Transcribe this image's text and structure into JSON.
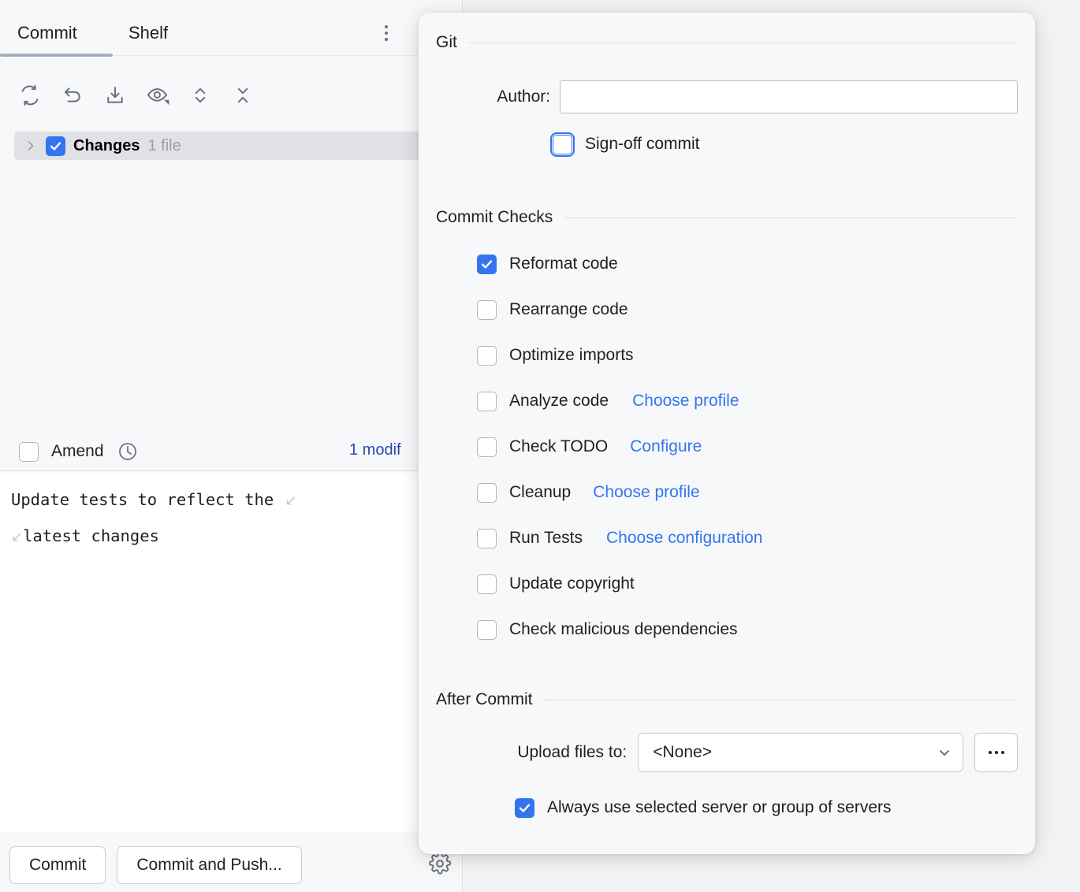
{
  "tool_window": {
    "tabs": [
      {
        "label": "Commit",
        "selected": true
      },
      {
        "label": "Shelf",
        "selected": false
      }
    ],
    "overflow_menu_icon": "kebab-menu-icon",
    "toolbar_icons": [
      "refresh-icon",
      "rollback-icon",
      "shelve-icon",
      "show-diff-eye-icon",
      "expand-all-icon",
      "collapse-all-icon"
    ],
    "changes_tree": {
      "expand_chevron": "chevron-right-icon",
      "checked": true,
      "label": "Changes",
      "count": "1 file"
    },
    "amend": {
      "checked": false,
      "label": "Amend",
      "history_icon": "clock-icon",
      "modified_link": "1 modif"
    },
    "commit_message": {
      "line1": "Update tests to reflect the",
      "line2": "latest changes",
      "wrap_marker": "↙"
    },
    "buttons": {
      "commit": "Commit",
      "commit_and_push": "Commit and Push...",
      "settings_icon": "gear-icon"
    }
  },
  "popup": {
    "git_section": {
      "title": "Git",
      "author_label": "Author:",
      "author_value": "",
      "author_placeholder": "",
      "signoff": {
        "label": "Sign-off commit",
        "checked": false,
        "focused": true
      }
    },
    "commit_checks_section": {
      "title": "Commit Checks",
      "items": [
        {
          "label": "Reformat code",
          "checked": true,
          "link": ""
        },
        {
          "label": "Rearrange code",
          "checked": false,
          "link": ""
        },
        {
          "label": "Optimize imports",
          "checked": false,
          "link": ""
        },
        {
          "label": "Analyze code",
          "checked": false,
          "link": "Choose profile"
        },
        {
          "label": "Check TODO",
          "checked": false,
          "link": "Configure"
        },
        {
          "label": "Cleanup",
          "checked": false,
          "link": "Choose profile"
        },
        {
          "label": "Run Tests",
          "checked": false,
          "link": "Choose configuration"
        },
        {
          "label": "Update copyright",
          "checked": false,
          "link": ""
        },
        {
          "label": "Check malicious dependencies",
          "checked": false,
          "link": ""
        }
      ]
    },
    "after_commit_section": {
      "title": "After Commit",
      "upload_label": "Upload files to:",
      "upload_value": "<None>",
      "upload_chevron_icon": "chevron-down-icon",
      "browse_button": "...",
      "always_use": {
        "label": "Always use selected server or group of servers",
        "checked": true
      }
    }
  },
  "colors": {
    "accent_blue": "#3574F0",
    "link_blue": "#3574F0",
    "panel_bg": "#F7F8FA",
    "selection_gray": "#DFE1E5",
    "tab_underline": "#A8ADBD",
    "modified_link": "#2B47B0"
  }
}
